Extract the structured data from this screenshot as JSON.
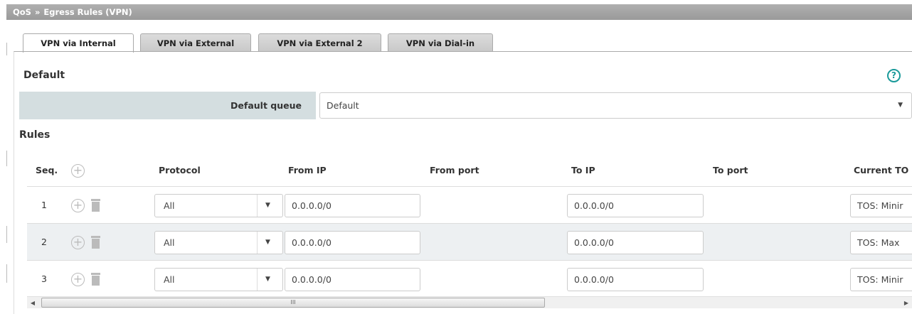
{
  "breadcrumb": {
    "root": "QoS",
    "separator": "»",
    "current": "Egress Rules (VPN)"
  },
  "tabs": [
    {
      "label": "VPN via Internal",
      "active": true
    },
    {
      "label": "VPN via External",
      "active": false
    },
    {
      "label": "VPN via External 2",
      "active": false
    },
    {
      "label": "VPN via Dial-in",
      "active": false
    }
  ],
  "default_section": {
    "title": "Default",
    "help": "?",
    "queue_label": "Default queue",
    "queue_value": "Default"
  },
  "rules_section": {
    "title": "Rules",
    "columns": {
      "seq": "Seq.",
      "protocol": "Protocol",
      "from_ip": "From IP",
      "from_port": "From port",
      "to_ip": "To IP",
      "to_port": "To port",
      "current_tos": "Current TO"
    },
    "rows": [
      {
        "seq": "1",
        "protocol": "All",
        "from_ip": "0.0.0.0/0",
        "to_ip": "0.0.0.0/0",
        "current_tos": "TOS: Minir"
      },
      {
        "seq": "2",
        "protocol": "All",
        "from_ip": "0.0.0.0/0",
        "to_ip": "0.0.0.0/0",
        "current_tos": "TOS: Max"
      },
      {
        "seq": "3",
        "protocol": "All",
        "from_ip": "0.0.0.0/0",
        "to_ip": "0.0.0.0/0",
        "current_tos": "TOS: Minir"
      }
    ]
  },
  "scrollbar": {
    "grip": "III"
  },
  "colors": {
    "accent": "#1a9a9a",
    "header_bg": "#a3a3a3",
    "label_bg": "#d4dee0",
    "alt_row": "#edf0f2"
  }
}
